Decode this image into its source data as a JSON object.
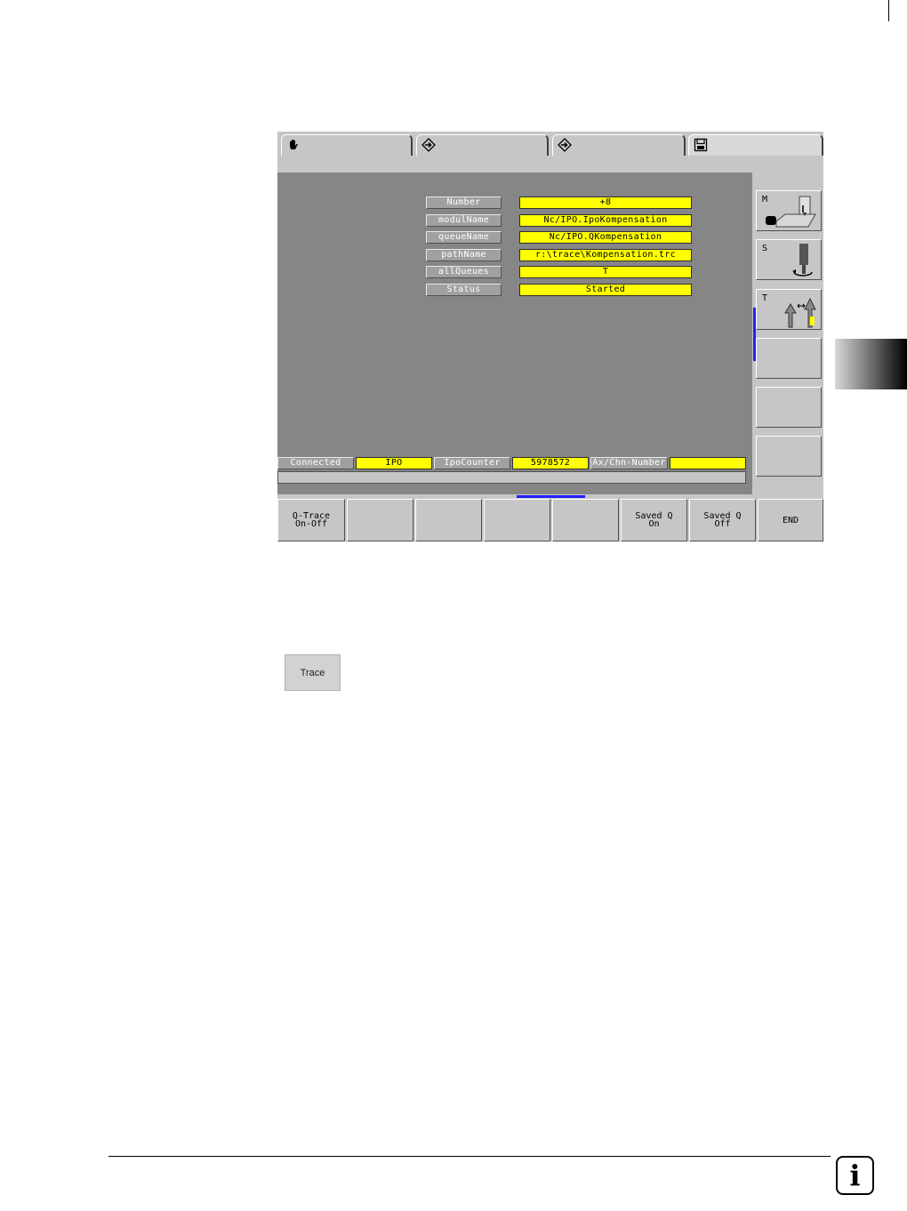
{
  "tabs": [
    {
      "icon": "hand-icon"
    },
    {
      "icon": "program-arrow-icon"
    },
    {
      "icon": "program-arrow-icon"
    },
    {
      "icon": "floppy-disk-icon"
    }
  ],
  "fields": [
    {
      "label": "Number",
      "value": "+8"
    },
    {
      "label": "modulName",
      "value": "Nc/IPO.IpoKompensation"
    },
    {
      "label": "queueName",
      "value": "Nc/IPO.QKompensation"
    },
    {
      "label": "pathName",
      "value": "r:\\trace\\Kompensation.trc"
    },
    {
      "label": "allQueues",
      "value": "T"
    },
    {
      "label": "Status",
      "value": "Started"
    }
  ],
  "statusbar": {
    "connected": "Connected",
    "ipo": "IPO",
    "ipocounter_label": "IpoCounter",
    "ipocounter_value": "5978572",
    "axchn_label": "Ax/Chn-Number",
    "axchn_value": ""
  },
  "side_keys": [
    {
      "letter": "M",
      "icon": "machine-icon"
    },
    {
      "letter": "S",
      "icon": "spindle-icon"
    },
    {
      "letter": "T",
      "icon": "tool-icon"
    },
    {
      "letter": ""
    },
    {
      "letter": ""
    },
    {
      "letter": ""
    }
  ],
  "softkeys": [
    "Q-Trace\nOn-Off",
    "",
    "",
    "",
    "",
    "Saved Q\nOn",
    "Saved Q\nOff",
    "END"
  ],
  "trace_button": "Trace",
  "colors": {
    "highlight": "#ffff00",
    "screen_bg": "#868686",
    "accent_blue": "#0000ff"
  }
}
